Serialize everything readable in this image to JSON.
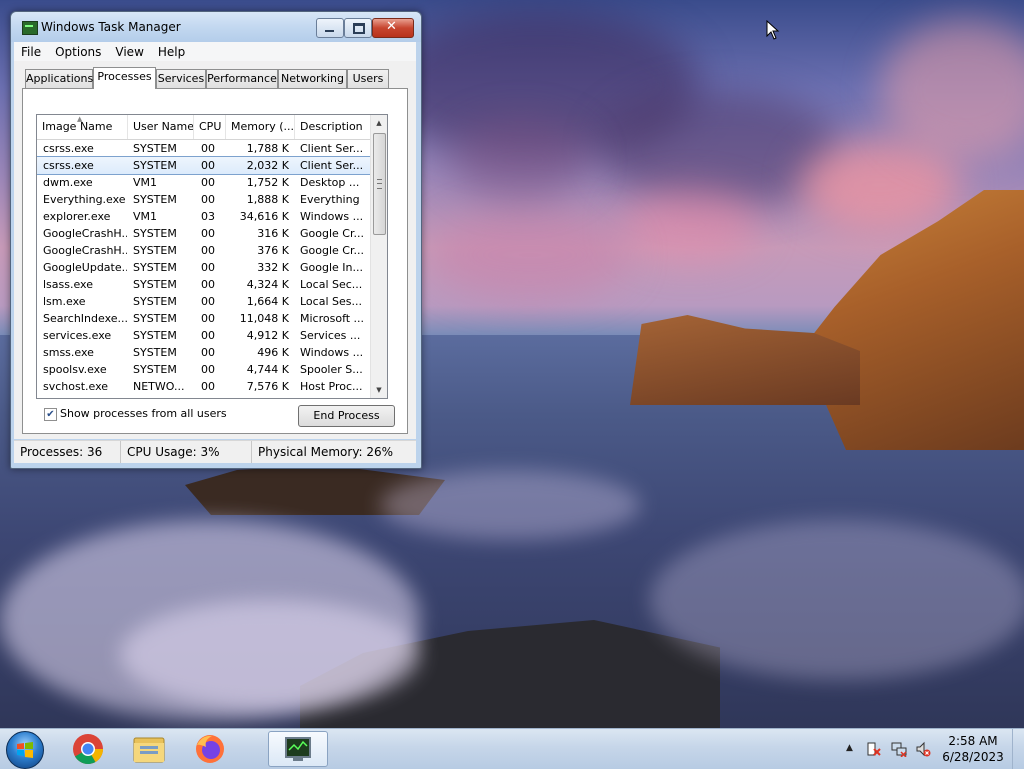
{
  "window": {
    "title": "Windows Task Manager",
    "menu": [
      "File",
      "Options",
      "View",
      "Help"
    ],
    "tabs": [
      "Applications",
      "Processes",
      "Services",
      "Performance",
      "Networking",
      "Users"
    ],
    "active_tab": "Processes",
    "columns": [
      "Image Name",
      "User Name",
      "CPU",
      "Memory (...",
      "Description"
    ],
    "rows": [
      {
        "name": "csrss.exe",
        "user": "SYSTEM",
        "cpu": "00",
        "mem": "1,788 K",
        "desc": "Client Ser..."
      },
      {
        "name": "csrss.exe",
        "user": "SYSTEM",
        "cpu": "00",
        "mem": "2,032 K",
        "desc": "Client Ser...",
        "selected": true
      },
      {
        "name": "dwm.exe",
        "user": "VM1",
        "cpu": "00",
        "mem": "1,752 K",
        "desc": "Desktop ..."
      },
      {
        "name": "Everything.exe",
        "user": "SYSTEM",
        "cpu": "00",
        "mem": "1,888 K",
        "desc": "Everything"
      },
      {
        "name": "explorer.exe",
        "user": "VM1",
        "cpu": "03",
        "mem": "34,616 K",
        "desc": "Windows ..."
      },
      {
        "name": "GoogleCrashH...",
        "user": "SYSTEM",
        "cpu": "00",
        "mem": "316 K",
        "desc": "Google Cr..."
      },
      {
        "name": "GoogleCrashH...",
        "user": "SYSTEM",
        "cpu": "00",
        "mem": "376 K",
        "desc": "Google Cr..."
      },
      {
        "name": "GoogleUpdate...",
        "user": "SYSTEM",
        "cpu": "00",
        "mem": "332 K",
        "desc": "Google In..."
      },
      {
        "name": "lsass.exe",
        "user": "SYSTEM",
        "cpu": "00",
        "mem": "4,324 K",
        "desc": "Local Sec..."
      },
      {
        "name": "lsm.exe",
        "user": "SYSTEM",
        "cpu": "00",
        "mem": "1,664 K",
        "desc": "Local Ses..."
      },
      {
        "name": "SearchIndexe...",
        "user": "SYSTEM",
        "cpu": "00",
        "mem": "11,048 K",
        "desc": "Microsoft ..."
      },
      {
        "name": "services.exe",
        "user": "SYSTEM",
        "cpu": "00",
        "mem": "4,912 K",
        "desc": "Services ..."
      },
      {
        "name": "smss.exe",
        "user": "SYSTEM",
        "cpu": "00",
        "mem": "496 K",
        "desc": "Windows ..."
      },
      {
        "name": "spoolsv.exe",
        "user": "SYSTEM",
        "cpu": "00",
        "mem": "4,744 K",
        "desc": "Spooler S..."
      },
      {
        "name": "svchost.exe",
        "user": "NETWO...",
        "cpu": "00",
        "mem": "7,576 K",
        "desc": "Host Proc..."
      }
    ],
    "show_all_label": "Show processes from all users",
    "show_all_checked": true,
    "end_process_label": "End Process",
    "status": {
      "processes": "Processes: 36",
      "cpu": "CPU Usage: 3%",
      "memory": "Physical Memory: 26%"
    }
  },
  "taskbar": {
    "apps": [
      {
        "name": "chrome-icon"
      },
      {
        "name": "file-explorer-icon"
      },
      {
        "name": "firefox-icon"
      },
      {
        "name": "task-manager-icon",
        "active": true
      }
    ],
    "tray_icons": [
      "action-center-icon",
      "network-icon",
      "volume-muted-icon"
    ],
    "time": "2:58 AM",
    "date": "6/28/2023"
  },
  "colors": {
    "selection_border": "#7da2ce",
    "title_bar": "#c3d8f0",
    "close_button": "#c7452f"
  }
}
